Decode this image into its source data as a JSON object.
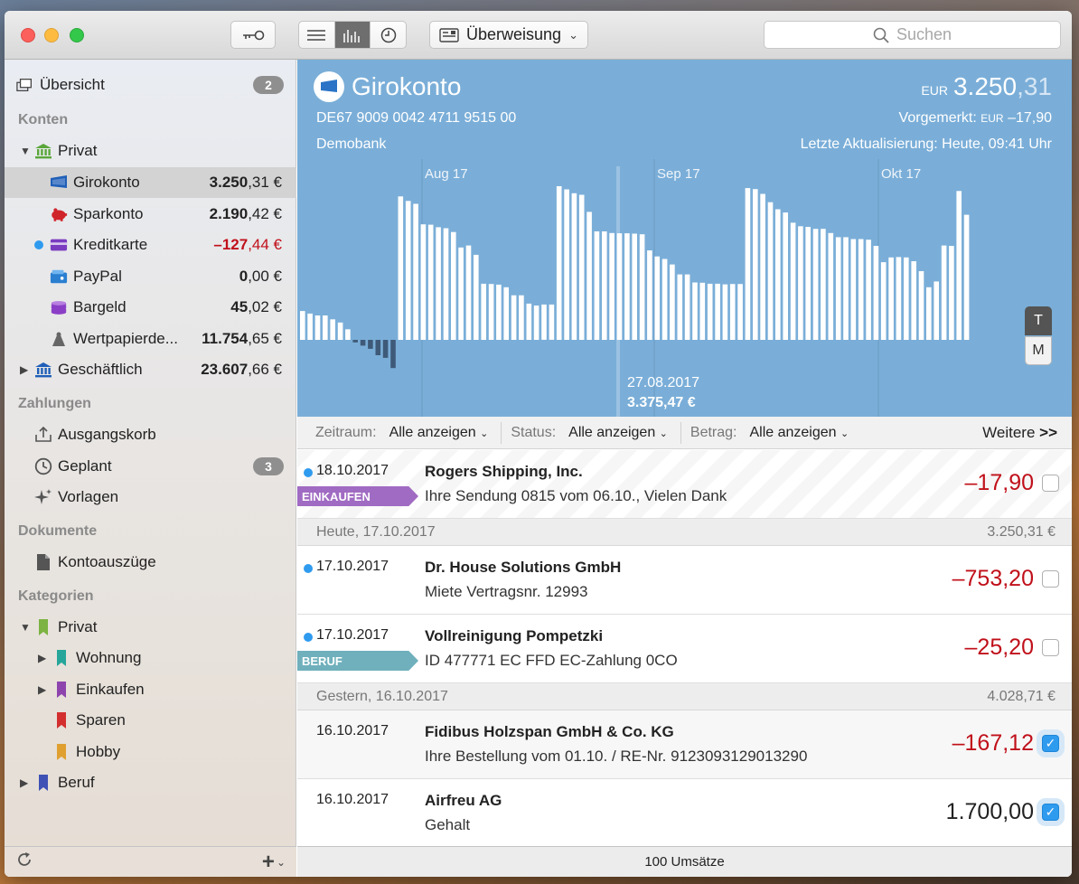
{
  "toolbar": {
    "transfer_label": "Überweisung",
    "search_placeholder": "Suchen"
  },
  "sidebar": {
    "overview": {
      "label": "Übersicht",
      "badge": "2"
    },
    "sections": {
      "accounts": "Konten",
      "payments": "Zahlungen",
      "documents": "Dokumente",
      "categories": "Kategorien"
    },
    "accounts": [
      {
        "label": "Privat",
        "amount": ""
      },
      {
        "label": "Girokonto",
        "int": "3.250",
        "dec": ",31 €"
      },
      {
        "label": "Sparkonto",
        "int": "2.190",
        "dec": ",42 €"
      },
      {
        "label": "Kreditkarte",
        "int": "–127",
        "dec": ",44 €"
      },
      {
        "label": "PayPal",
        "int": "0",
        "dec": ",00 €"
      },
      {
        "label": "Bargeld",
        "int": "45",
        "dec": ",02 €"
      },
      {
        "label": "Wertpapierde...",
        "int": "11.754",
        "dec": ",65 €"
      },
      {
        "label": "Geschäftlich",
        "int": "23.607",
        "dec": ",66 €"
      }
    ],
    "payments": [
      {
        "label": "Ausgangskorb"
      },
      {
        "label": "Geplant",
        "badge": "3"
      },
      {
        "label": "Vorlagen"
      }
    ],
    "documents": [
      {
        "label": "Kontoauszüge"
      }
    ],
    "categories": [
      {
        "label": "Privat",
        "color": "#7cb342"
      },
      {
        "label": "Wohnung",
        "color": "#26a69a"
      },
      {
        "label": "Einkaufen",
        "color": "#8e44ad"
      },
      {
        "label": "Sparen",
        "color": "#d32f2f"
      },
      {
        "label": "Hobby",
        "color": "#e0a030"
      },
      {
        "label": "Beruf",
        "color": "#3f51b5"
      }
    ]
  },
  "account": {
    "title": "Girokonto",
    "iban": "DE67 9009 0042 4711 9515 00",
    "bank": "Demobank",
    "currency": "EUR",
    "balance_int": "3.250",
    "balance_dec": ",31",
    "pre_label": "Vorgemerkt:",
    "pre_currency": "EUR",
    "pre_value": "–17,90",
    "updated": "Letzte Aktualisierung: Heute, 09:41 Uhr"
  },
  "chart_data": {
    "type": "bar",
    "months": [
      "Aug 17",
      "Sep 17",
      "Okt 17"
    ],
    "values": [
      900,
      820,
      760,
      760,
      640,
      540,
      330,
      -80,
      -180,
      -280,
      -480,
      -560,
      -880,
      4470,
      4330,
      4240,
      3600,
      3590,
      3510,
      3480,
      3360,
      2880,
      2940,
      2650,
      1750,
      1740,
      1720,
      1640,
      1390,
      1390,
      1130,
      1070,
      1100,
      1100,
      4790,
      4690,
      4570,
      4520,
      3990,
      3380,
      3380,
      3330,
      3320,
      3320,
      3310,
      3290,
      2790,
      2600,
      2520,
      2350,
      2040,
      2040,
      1790,
      1780,
      1750,
      1750,
      1730,
      1740,
      1740,
      4730,
      4700,
      4550,
      4290,
      4070,
      3970,
      3650,
      3540,
      3520,
      3460,
      3460,
      3330,
      3200,
      3200,
      3140,
      3140,
      3120,
      2930,
      2420,
      2570,
      2580,
      2570,
      2450,
      2140,
      1640,
      1820,
      2940,
      2930,
      4640,
      3900
    ],
    "tooltip_date": "27.08.2017",
    "tooltip_value": "3.375,47 €",
    "range_buttons": [
      "T",
      "M"
    ]
  },
  "filters": {
    "period_label": "Zeitraum:",
    "period_value": "Alle anzeigen",
    "status_label": "Status:",
    "status_value": "Alle anzeigen",
    "amount_label": "Betrag:",
    "amount_value": "Alle anzeigen",
    "more": "Weitere"
  },
  "transactions": {
    "pending": {
      "date": "18.10.2017",
      "name": "Rogers Shipping, Inc.",
      "desc": "Ihre Sendung 0815 vom 06.10., Vielen Dank",
      "amount": "–17,90",
      "tag": "EINKAUFEN"
    },
    "day1": {
      "label": "Heute, 17.10.2017",
      "sum": "3.250,31 €"
    },
    "tx1": {
      "date": "17.10.2017",
      "name": "Dr. House Solutions GmbH",
      "desc": "Miete Vertragsnr. 12993",
      "amount": "–753,20"
    },
    "tx2": {
      "date": "17.10.2017",
      "name": "Vollreinigung Pompetzki",
      "desc": "ID 477771 EC FFD EC-Zahlung 0CO",
      "amount": "–25,20",
      "tag": "BERUF"
    },
    "day2": {
      "label": "Gestern, 16.10.2017",
      "sum": "4.028,71 €"
    },
    "tx3": {
      "date": "16.10.2017",
      "name": "Fidibus Holzspan GmbH & Co. KG",
      "desc": "Ihre Bestellung vom 01.10. / RE-Nr. 9123093129013290",
      "amount": "–167,12"
    },
    "tx4": {
      "date": "16.10.2017",
      "name": "Airfreu AG",
      "desc": "Gehalt",
      "amount": "1.700,00"
    }
  },
  "status": {
    "count": "100 Umsätze"
  }
}
